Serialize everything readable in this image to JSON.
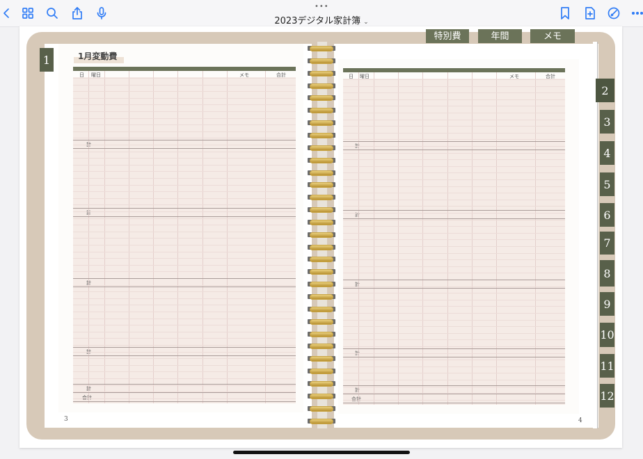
{
  "toolbar": {
    "title": "2023デジタル家計簿",
    "chevron": "⌄",
    "dots": "•••"
  },
  "top_tabs": [
    "特別費",
    "年間",
    "メモ"
  ],
  "side_tabs": [
    "2",
    "3",
    "4",
    "5",
    "6",
    "7",
    "8",
    "9",
    "10",
    "11",
    "12"
  ],
  "left_tab": "1",
  "left_page": {
    "title": "1月変動費",
    "headers": {
      "day": "日",
      "weekday": "曜日",
      "memo": "メモ",
      "total": "合計"
    },
    "subtotal_label": "計",
    "grand_total_label": "合計",
    "page_number": "3"
  },
  "right_page": {
    "headers": {
      "day": "日",
      "weekday": "曜日",
      "memo": "メモ",
      "total": "合計"
    },
    "subtotal_label": "計",
    "grand_total_label": "合計",
    "page_number": "4"
  },
  "colors": {
    "tab": "#58604a",
    "cover": "#d7c9b8",
    "header_bar": "#6b7359",
    "table_fill": "#f5ebe6"
  }
}
